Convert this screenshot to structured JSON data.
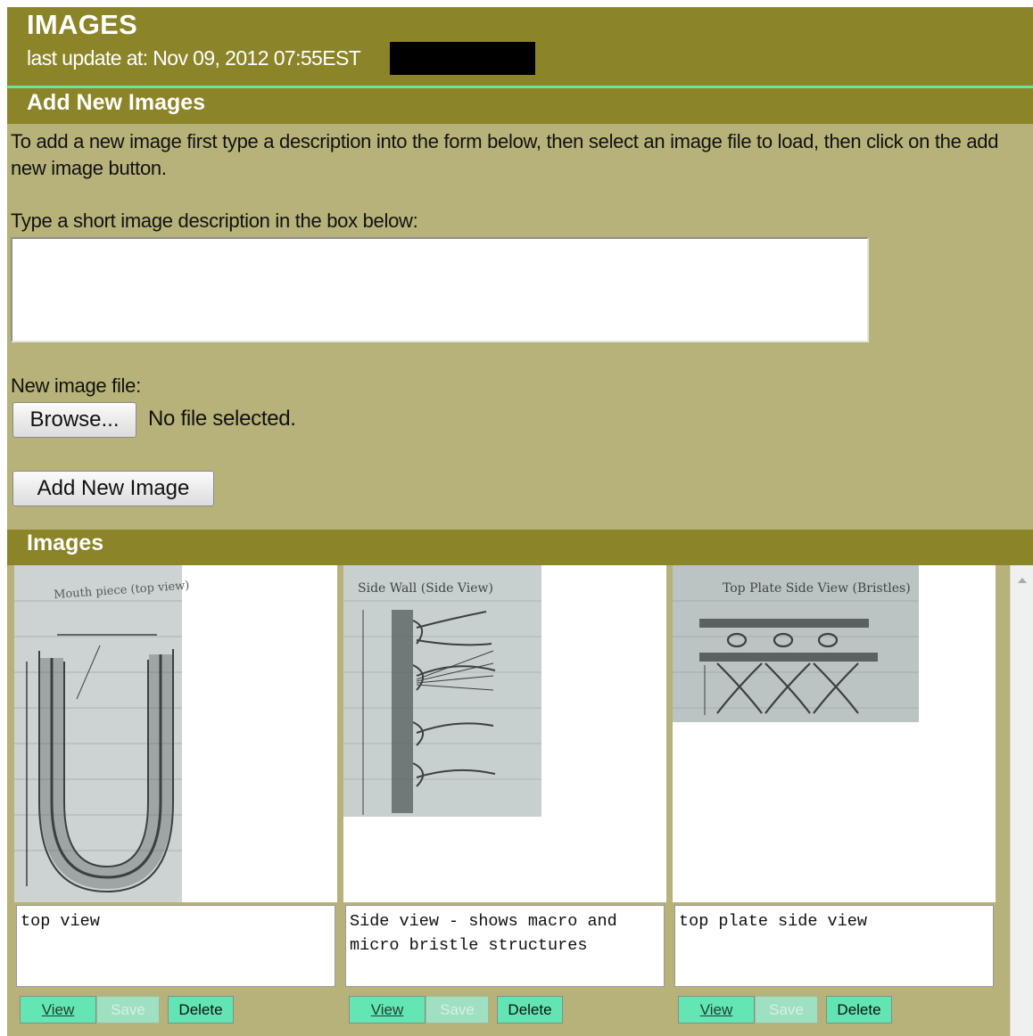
{
  "header": {
    "title": "IMAGES",
    "last_update": "last update at: Nov 09, 2012 07:55EST"
  },
  "add_section": {
    "title": "Add New Images",
    "instructions": "To add a new image first type a description into the form below, then select an image file to load, then click on the add new image button.",
    "description_label": "Type a short image description in the box below:",
    "description_value": "",
    "file_label": "New image file:",
    "browse_label": "Browse...",
    "file_status": "No file selected.",
    "add_button_label": "Add New Image"
  },
  "images_section": {
    "title": "Images",
    "items": [
      {
        "sketch_labels": [
          "Mouth piece (top view)"
        ],
        "description": "top view",
        "view_label": "View",
        "save_label": "Save",
        "delete_label": "Delete"
      },
      {
        "sketch_labels": [
          "Side Wall (Side View)"
        ],
        "description": "Side view - shows macro and micro bristle structures",
        "view_label": "View",
        "save_label": "Save",
        "delete_label": "Delete"
      },
      {
        "sketch_labels": [
          "Top Plate Side View (Bristles)"
        ],
        "description": "top plate side view",
        "view_label": "View",
        "save_label": "Save",
        "delete_label": "Delete"
      }
    ]
  },
  "colors": {
    "header_bg": "#8b8429",
    "panel_bg": "#b7b27a",
    "accent_line": "#6ee39f",
    "action_button": "#63e6b4"
  }
}
